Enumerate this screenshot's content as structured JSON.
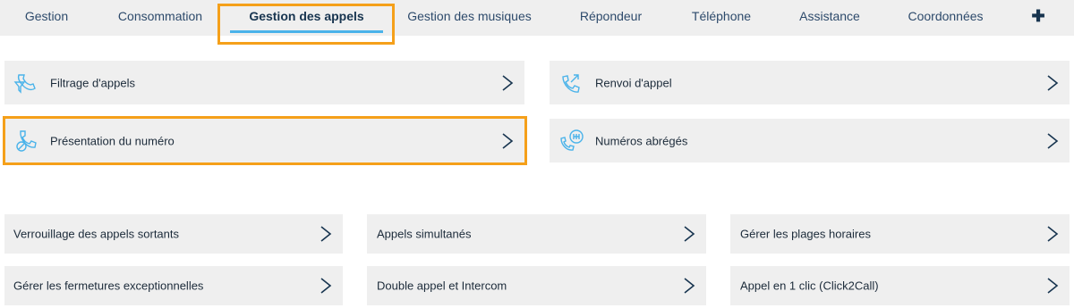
{
  "tabs": [
    {
      "label": "Gestion"
    },
    {
      "label": "Consommation"
    },
    {
      "label": "Gestion des appels"
    },
    {
      "label": "Gestion des musiques"
    },
    {
      "label": "Répondeur"
    },
    {
      "label": "Téléphone"
    },
    {
      "label": "Assistance"
    },
    {
      "label": "Coordonnées"
    }
  ],
  "more_tab_icon": "plus-icon",
  "featured": [
    {
      "label": "Filtrage d'appels",
      "icon": "call-filter-icon"
    },
    {
      "label": "Renvoi d'appel",
      "icon": "call-forward-icon"
    },
    {
      "label": "Présentation du numéro",
      "icon": "number-display-icon"
    },
    {
      "label": "Numéros abrégés",
      "icon": "speed-dial-icon"
    }
  ],
  "options": [
    {
      "label": "Verrouillage des appels sortants"
    },
    {
      "label": "Appels simultanés"
    },
    {
      "label": "Gérer les plages horaires"
    },
    {
      "label": "Gérer les fermetures exceptionnelles"
    },
    {
      "label": "Double appel et Intercom"
    },
    {
      "label": "Appel en 1 clic (Click2Call)"
    }
  ],
  "colors": {
    "accent": "#4ab3ea",
    "highlight": "#f5a01a",
    "row_bg": "#efefef",
    "text": "#1c2b3a"
  }
}
